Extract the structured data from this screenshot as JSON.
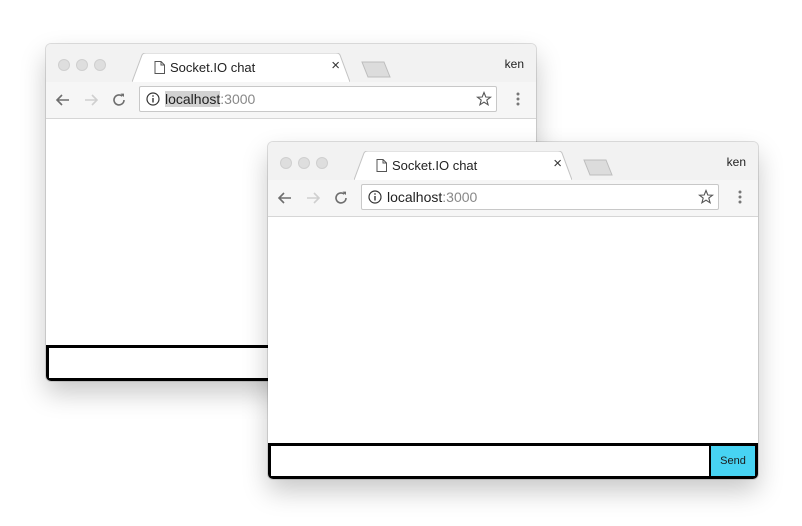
{
  "windows": [
    {
      "tab": {
        "title": "Socket.IO chat",
        "close": "×"
      },
      "profile": "ken",
      "address": {
        "host": "localhost",
        "port": ":3000"
      },
      "chat": {
        "input_value": ""
      }
    },
    {
      "tab": {
        "title": "Socket.IO chat",
        "close": "×"
      },
      "profile": "ken",
      "address": {
        "host": "localhost",
        "port": ":3000"
      },
      "chat": {
        "input_value": "",
        "send_label": "Send"
      }
    }
  ],
  "colors": {
    "send_button": "#47d3f3",
    "form_border": "#000000"
  },
  "icons": [
    "document-icon",
    "close-icon",
    "new-tab-icon",
    "back-icon",
    "forward-icon",
    "reload-icon",
    "info-icon",
    "star-icon",
    "menu-icon"
  ]
}
